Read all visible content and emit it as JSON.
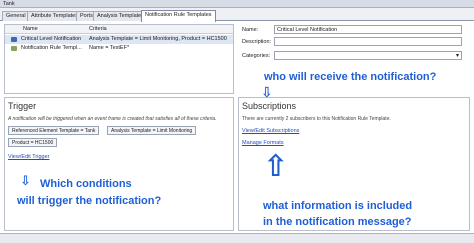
{
  "window": {
    "title": "Tank"
  },
  "tabs": [
    {
      "label": "General"
    },
    {
      "label": "Attribute Templates"
    },
    {
      "label": "Ports"
    },
    {
      "label": "Analysis Templates"
    },
    {
      "label": "Notification Rule Templates"
    }
  ],
  "grid": {
    "columns": {
      "name": "Name",
      "criteria": "Criteria"
    },
    "rows": [
      {
        "name": "Critical Level Notification",
        "criteria": "Analysis Template = Limit Monitoring, Product = HC1500"
      },
      {
        "name": "Notification Rule Templ...",
        "criteria": "Name = TestEF*"
      }
    ]
  },
  "form": {
    "name_label": "Name:",
    "name_value": "Critical Level Notification",
    "description_label": "Description:",
    "description_value": "",
    "categories_label": "Categories:",
    "categories_value": ""
  },
  "trigger": {
    "title": "Trigger",
    "description": "A notification will be triggered when an event frame is created that satisfies all of these criteria.",
    "criteria": [
      "Referenced Element Template = Tank",
      "Analysis Template = Limit Monitoring",
      "Product = HC1500"
    ],
    "link": "View/Edit Trigger"
  },
  "subscriptions": {
    "title": "Subscriptions",
    "description": "There are currently 2 subscribers to this Notification Rule Template.",
    "link_subscriptions": "View/Edit Subscriptions",
    "link_formats": "Manage Formats"
  },
  "annotations": {
    "who": "who will receive the notification?",
    "conditions_line1": "Which conditions",
    "conditions_line2": "will trigger the notification?",
    "info_line1": "what information is included",
    "info_line2": "in the notification message?",
    "arrow_down": "⇩",
    "arrow_up": "⇧",
    "color": "#1f5fd6"
  }
}
